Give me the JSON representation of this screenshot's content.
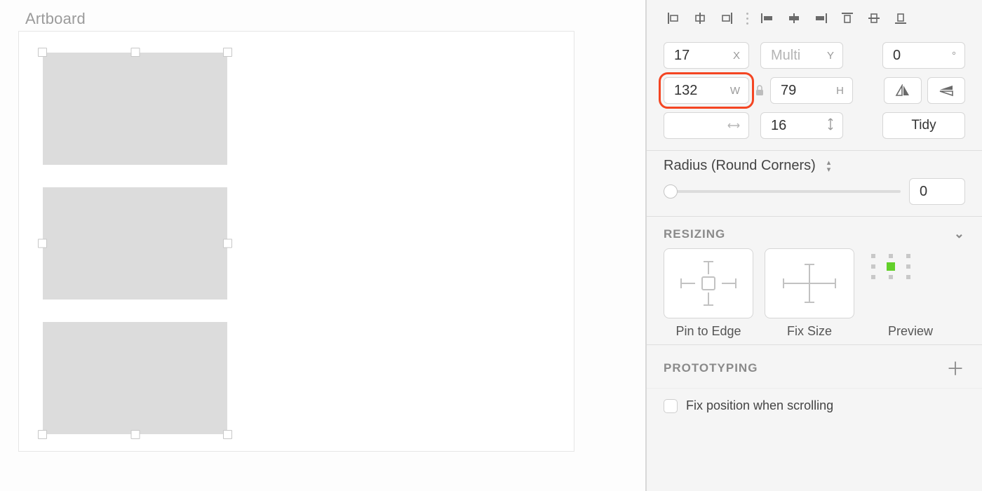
{
  "artboard": {
    "label": "Artboard"
  },
  "transform": {
    "x": "17",
    "x_suffix": "X",
    "y_placeholder": "Multi",
    "y_suffix": "Y",
    "rotation": "0",
    "rotation_suffix": "°",
    "w": "132",
    "w_suffix": "W",
    "h": "79",
    "h_suffix": "H",
    "spacing": "16",
    "tidy_label": "Tidy"
  },
  "radius": {
    "label": "Radius (Round Corners)",
    "value": "0"
  },
  "resizing": {
    "header": "RESIZING",
    "pin_label": "Pin to Edge",
    "fix_label": "Fix Size",
    "preview_label": "Preview"
  },
  "prototyping": {
    "header": "PROTOTYPING",
    "fix_position_label": "Fix position when scrolling"
  }
}
